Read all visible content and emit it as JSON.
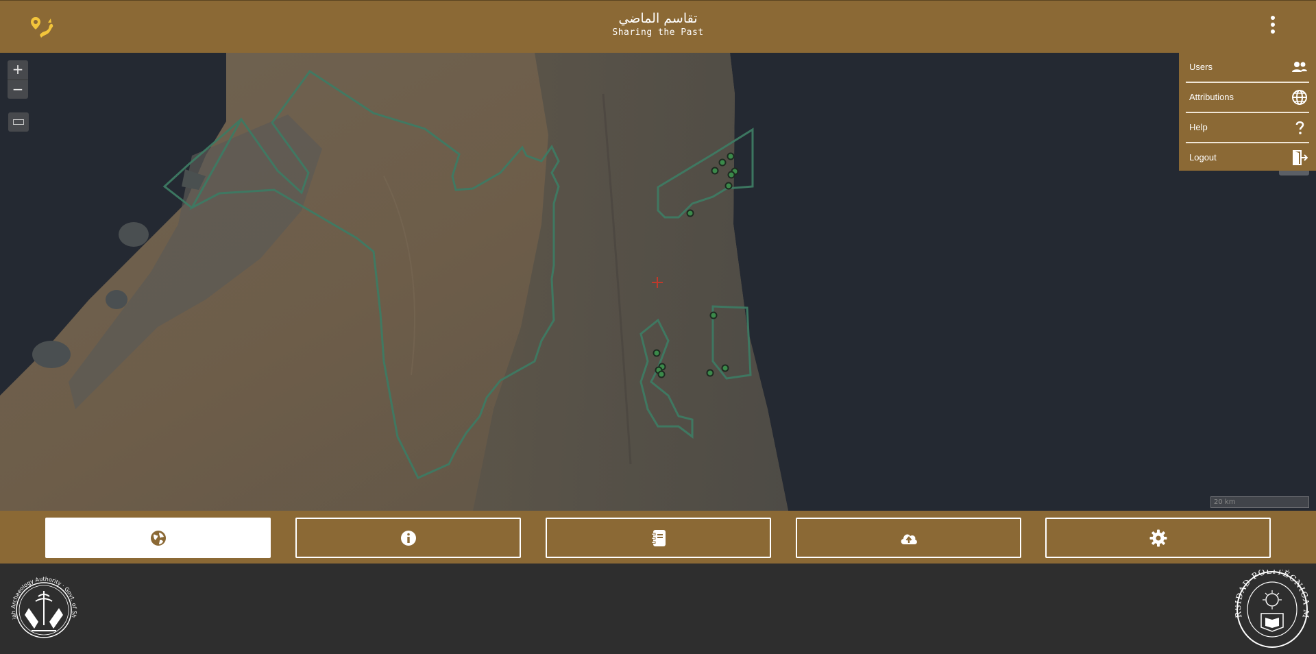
{
  "header": {
    "title_arabic": "تقاسم الماضي",
    "title_english": "Sharing the Past",
    "logo_icon": "map-pin-dragon-icon",
    "menu_icon": "kebab-menu-icon"
  },
  "map": {
    "zoom_in_label": "+",
    "zoom_out_label": "−",
    "measure_icon": "ruler-icon",
    "scale_label": "20 km",
    "center_marker_icon": "crosshair-icon"
  },
  "menu": {
    "items": [
      {
        "label": "Users",
        "icon": "users-icon"
      },
      {
        "label": "Attributions",
        "icon": "globe-icon"
      },
      {
        "label": "Help",
        "icon": "question-icon"
      },
      {
        "label": "Logout",
        "icon": "logout-icon"
      }
    ]
  },
  "bottom_nav": {
    "items": [
      {
        "icon": "globe-icon",
        "active": true
      },
      {
        "icon": "info-icon",
        "active": false
      },
      {
        "icon": "notebook-icon",
        "active": false
      },
      {
        "icon": "cloud-upload-icon",
        "active": false
      },
      {
        "icon": "gear-icon",
        "active": false
      }
    ]
  },
  "footer": {
    "left_seal_text": "Sharjah Archaeology Authority · Govt. of Sharjah",
    "right_seal_text": "UNIVERSIDAD POLITÉCNICA MADRID"
  },
  "colors": {
    "brand": "#8b6935",
    "map_background": "#242932",
    "region_outline": "#3e7a63",
    "site_marker": "#3b8a4a",
    "crosshair": "#c0392b"
  }
}
